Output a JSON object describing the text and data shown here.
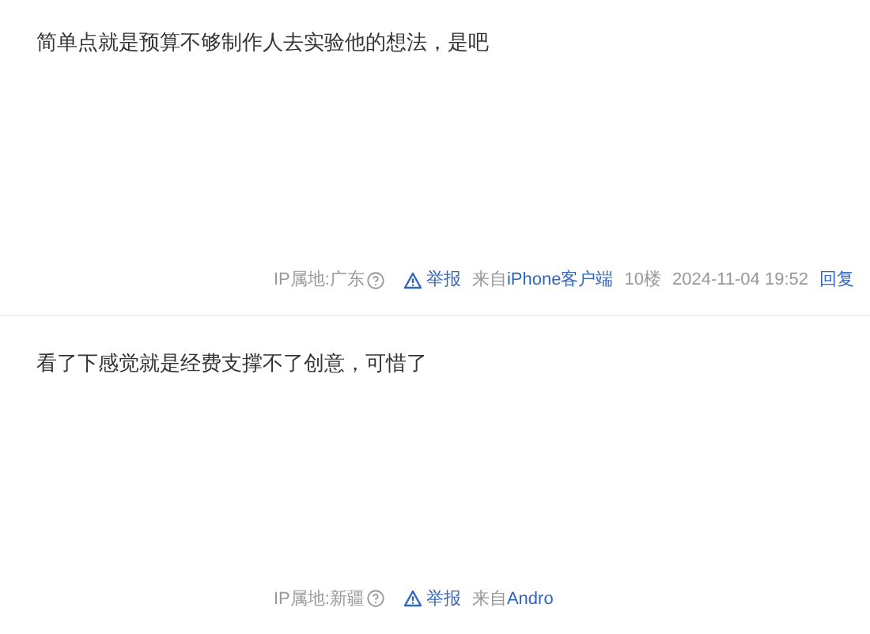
{
  "posts": [
    {
      "text": "简单点就是预算不够制作人去实验他的想法，是吧",
      "ip": "IP属地:广东",
      "report": "举报",
      "source_prefix": "来自",
      "source": "iPhone客户端",
      "floor": "10楼",
      "time": "2024-11-04 19:52",
      "reply": "回复"
    },
    {
      "text": "看了下感觉就是经费支撑不了创意，可惜了",
      "ip": "IP属地:新疆",
      "report": "举报",
      "source_prefix": "来自",
      "source": "Andro"
    }
  ]
}
